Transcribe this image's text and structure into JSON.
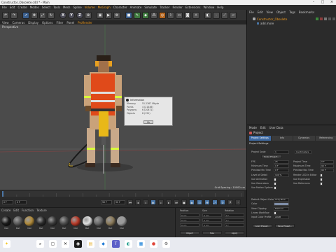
{
  "window": {
    "title": "Constructor_Obsolete.c4d * - Main"
  },
  "menubar": {
    "items": [
      "File",
      "Edit",
      "Create",
      "Modes",
      "Select",
      "Tools",
      "Mesh",
      "Spline",
      "Volume",
      "MoGraph",
      "Character",
      "Animate",
      "Simulate",
      "Tracker",
      "Render",
      "Extensions",
      "Window",
      "Help"
    ],
    "highlight": [
      "Volume",
      "MoGraph"
    ]
  },
  "toolbar": {
    "axes": [
      "X",
      "Y",
      "Z"
    ]
  },
  "viewport": {
    "menu": [
      "View",
      "Cameras",
      "Display",
      "Options",
      "Filter",
      "Panel",
      "ProRender"
    ],
    "menu_highlight": "ProRender",
    "label": "Perspective",
    "grid_spacing": "Grid Spacing : 10000 cm"
  },
  "info_dialog": {
    "title": "Information",
    "rows": [
      {
        "k": "Memory",
        "v": "51.2367 Mbyte"
      },
      {
        "k": "Points",
        "v": "4 (21446)"
      },
      {
        "k": "Polygons",
        "v": "6 (20871)"
      },
      {
        "k": "Objects",
        "v": "8 (151)"
      }
    ],
    "ok_label": "Ok"
  },
  "timeline": {
    "frame_start": "0 F",
    "frame_current": "0 F",
    "frame_end": "90 F",
    "frame_end2": "90 F"
  },
  "material_manager": {
    "menu": [
      "Create",
      "Edit",
      "Function",
      "Texture"
    ],
    "materials": [
      {
        "name": "Mat",
        "color": "#1a1a1a"
      },
      {
        "name": "Mat",
        "color": "#5a5a5a"
      },
      {
        "name": "Mat",
        "color": "#b08a3a"
      },
      {
        "name": "Mat",
        "color": "#2a2a2a"
      },
      {
        "name": "Mat",
        "color": "#3a3a3a"
      },
      {
        "name": "Mat",
        "color": "#4a4a4a"
      },
      {
        "name": "Mat",
        "color": "#b83a28"
      },
      {
        "name": "Mat",
        "color": "#e0e0e0"
      },
      {
        "name": "Mat",
        "color": "#6a6a6a"
      },
      {
        "name": "Mat",
        "color": "#8a7a5a"
      },
      {
        "name": "Mat",
        "color": "#9a9a9a"
      }
    ]
  },
  "coord_manager": {
    "pos_label": "Position",
    "size_label": "Size",
    "rot_label": "Rotation",
    "apply_label": "Apply",
    "fields": [
      "0 cm",
      "0 cm",
      "0 cm",
      "0 cm",
      "0 cm",
      "0 cm",
      "0 °",
      "0 °",
      "0 °"
    ],
    "mode1": "Object",
    "mode2": "Size"
  },
  "object_manager": {
    "menu": [
      "File",
      "Edit",
      "View",
      "Object",
      "Tags",
      "Bookmarks"
    ],
    "object_name": "Constructor_Obsolete",
    "child_name": "add.more"
  },
  "attribute_manager": {
    "menu": [
      "Mode",
      "Edit",
      "User Data"
    ],
    "title": "Project",
    "tabs": [
      "Project Settings",
      "Info",
      "Dynamics",
      "Referencing"
    ],
    "section": "Project Settings",
    "rows_left": [
      {
        "label": "Project Scale",
        "value": "1"
      },
      {
        "label": "FPS",
        "value": "25"
      },
      {
        "label": "Minimum Time",
        "value": "0 F"
      },
      {
        "label": "Preview Min Time",
        "value": "0 F"
      },
      {
        "label": "Level of Detail",
        "value": "100 %"
      },
      {
        "label": "Use Animation",
        "value": ""
      },
      {
        "label": "Use Generators",
        "value": ""
      },
      {
        "label": "Use Motion System",
        "value": ""
      },
      {
        "label": "Default Object Color",
        "value": "Gray-Blue"
      },
      {
        "label": "Color",
        "value": ""
      },
      {
        "label": "View Clipping",
        "value": "Medium"
      },
      {
        "label": "Linear Workflow",
        "value": ""
      },
      {
        "label": "Input Color Profile",
        "value": "sRGB"
      }
    ],
    "rows_right": [
      {
        "label": "Project Time",
        "value": "0 F"
      },
      {
        "label": "Maximum Time",
        "value": "90 F"
      },
      {
        "label": "Preview Max Time",
        "value": "90 F"
      },
      {
        "label": "Render LOD in Editor",
        "value": ""
      },
      {
        "label": "Use Expression",
        "value": ""
      },
      {
        "label": "Use Deformers",
        "value": ""
      }
    ],
    "scale_unit": "Centimeters",
    "scale_button": "Scale Project...",
    "load_button": "Load Preset...",
    "save_button": "Save Preset..."
  },
  "taskbar": {
    "icons": [
      "start-icon",
      "search-icon",
      "taskview-icon",
      "close-icon",
      "cinema4d-icon",
      "explorer-icon",
      "vscode-icon",
      "teams-icon",
      "edge-icon",
      "store-icon",
      "chrome-icon",
      "settings-icon"
    ]
  }
}
